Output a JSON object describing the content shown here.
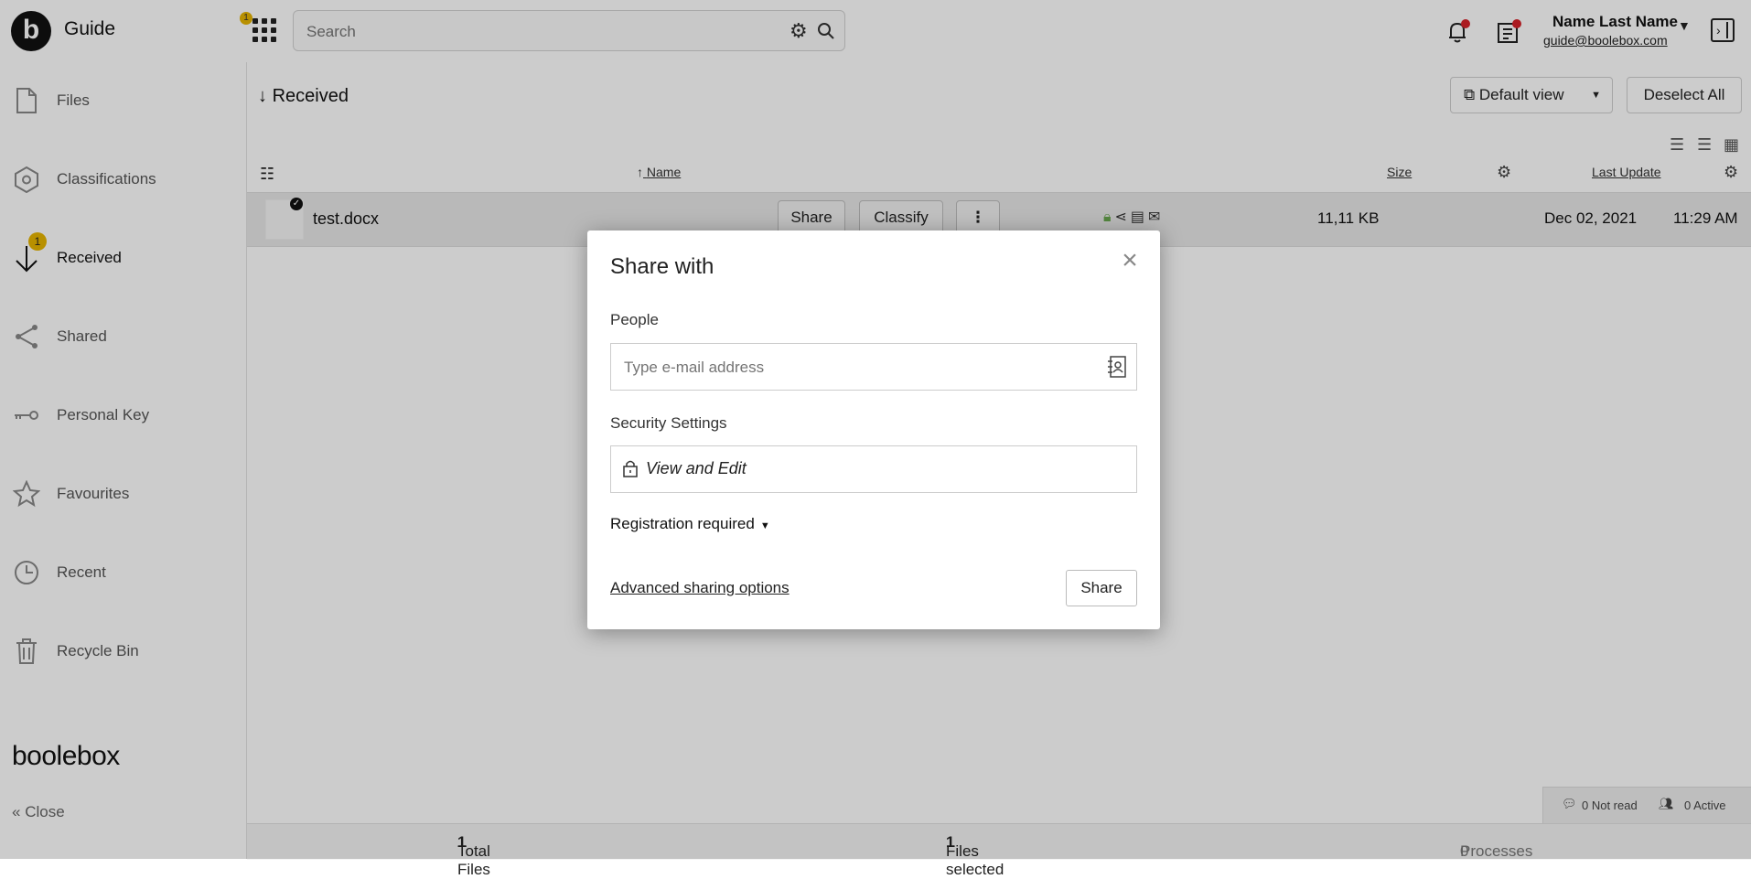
{
  "header": {
    "app_title": "Guide",
    "logo_letter": "b",
    "apps_badge": "1",
    "search_placeholder": "Search",
    "user_name": "Name Last Name",
    "user_email": "guide@boolebox.com"
  },
  "sidebar": {
    "items": [
      {
        "label": "Files",
        "icon": "file-icon"
      },
      {
        "label": "Classifications",
        "icon": "hexagon-icon"
      },
      {
        "label": "Received",
        "icon": "arrow-down-icon",
        "badge": "1",
        "active": true
      },
      {
        "label": "Shared",
        "icon": "share-icon"
      },
      {
        "label": "Personal Key",
        "icon": "key-icon"
      },
      {
        "label": "Favourites",
        "icon": "star-icon"
      },
      {
        "label": "Recent",
        "icon": "clock-icon"
      },
      {
        "label": "Recycle Bin",
        "icon": "trash-icon"
      }
    ],
    "brand": "boolebox",
    "close_label": "Close"
  },
  "main": {
    "breadcrumb": "Received",
    "view_select": "Default view",
    "deselect_label": "Deselect All",
    "columns": {
      "name": "Name",
      "size": "Size",
      "last_update": "Last Update"
    },
    "rows": [
      {
        "name": "test.docx",
        "share": "Share",
        "classify": "Classify",
        "size": "11,11 KB",
        "date": "Dec 02, 2021",
        "time": "11:29 AM"
      }
    ],
    "chat": {
      "not_read": "0 Not read",
      "active": "0 Active"
    },
    "footer": {
      "total_label": "Total Files",
      "total_value": "1",
      "selected_label": "Files selected",
      "selected_value": "1",
      "processes_value": "0",
      "processes_label": "Processes"
    }
  },
  "modal": {
    "title": "Share with",
    "people_label": "People",
    "email_placeholder": "Type e-mail address",
    "security_label": "Security Settings",
    "security_value": "View and Edit",
    "registration": "Registration required",
    "advanced_link": "Advanced sharing options",
    "share_button": "Share"
  },
  "colors": {
    "accent_badge": "#e6b400",
    "alert_dot": "#d6222a",
    "lock_green": "#6aa84f"
  }
}
